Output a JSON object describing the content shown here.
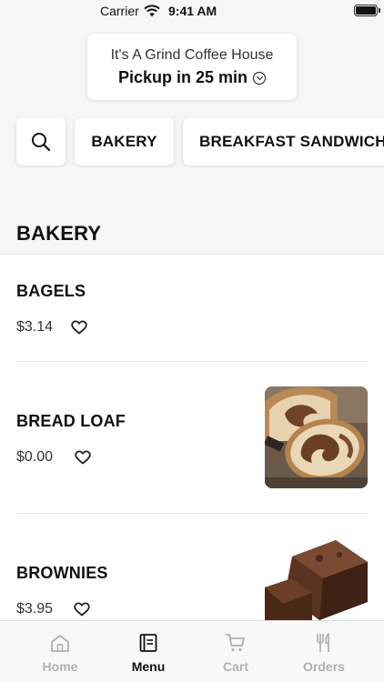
{
  "status": {
    "carrier": "Carrier",
    "time": "9:41 AM"
  },
  "store": {
    "name": "It's A Grind Coffee House",
    "pickup": "Pickup in 25 min"
  },
  "categories": [
    {
      "label": "BAKERY"
    },
    {
      "label": "BREAKFAST SANDWICH"
    }
  ],
  "section": {
    "title": "BAKERY"
  },
  "items": [
    {
      "name": "BAGELS",
      "price": "$3.14"
    },
    {
      "name": "BREAD LOAF",
      "price": "$0.00"
    },
    {
      "name": "BROWNIES",
      "price": "$3.95"
    }
  ],
  "tabs": [
    {
      "label": "Home",
      "icon": "home-icon"
    },
    {
      "label": "Menu",
      "icon": "menu-icon"
    },
    {
      "label": "Cart",
      "icon": "cart-icon"
    },
    {
      "label": "Orders",
      "icon": "orders-icon"
    }
  ],
  "colors": {
    "active_tab": "#111111",
    "inactive_tab": "#b0b0b0",
    "background": "#f6f6f6"
  }
}
